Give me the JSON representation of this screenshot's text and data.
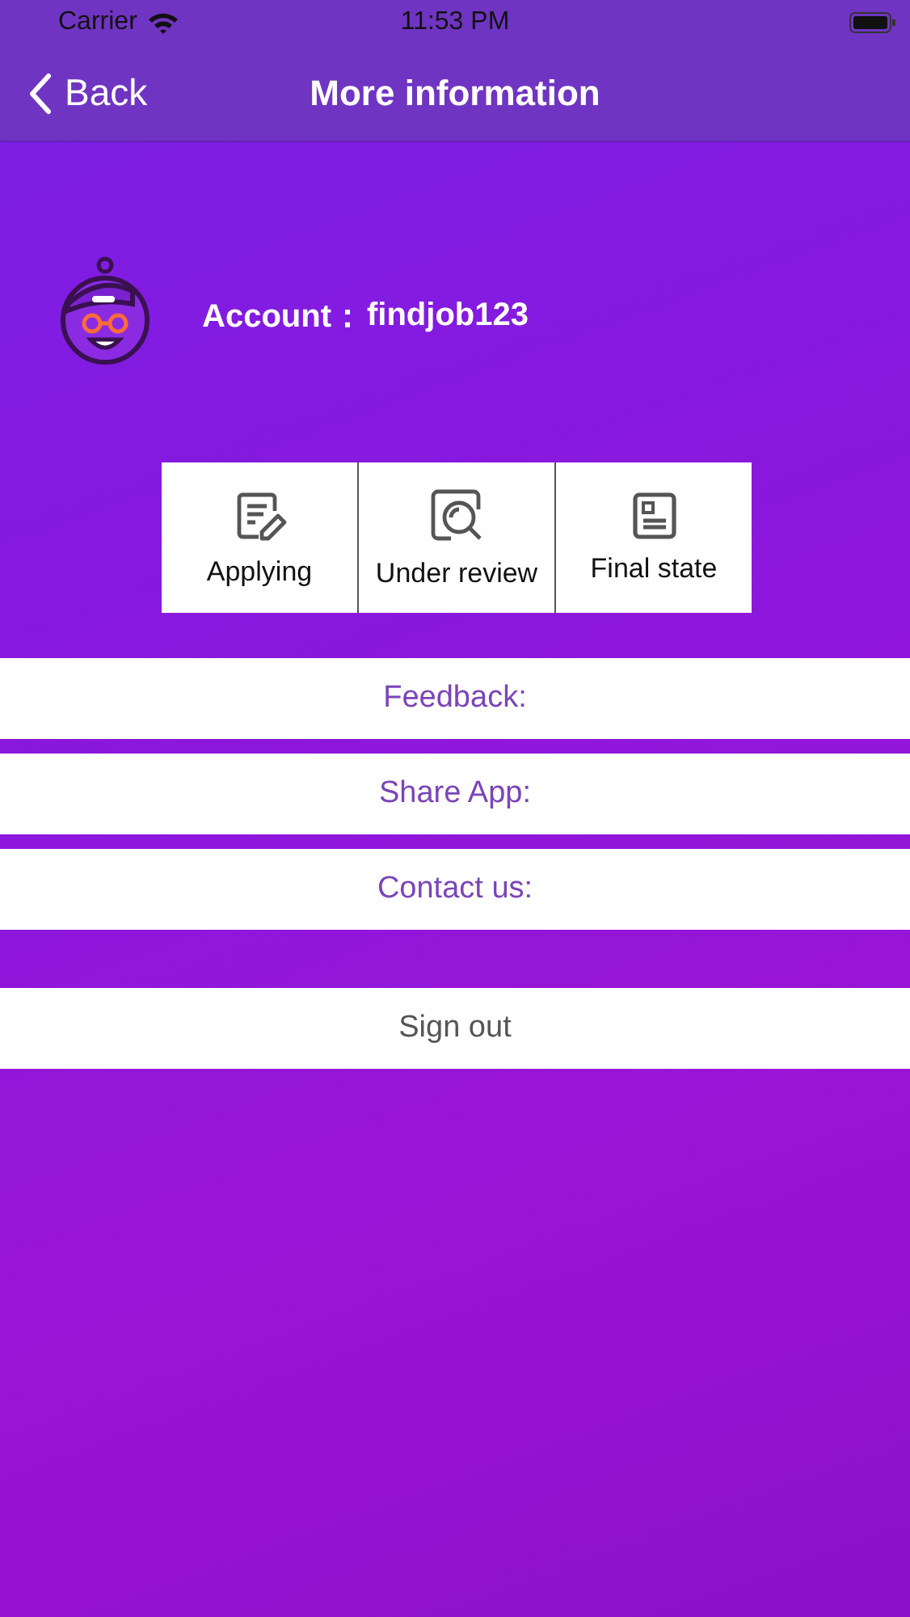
{
  "status_bar": {
    "carrier": "Carrier",
    "time": "11:53 PM"
  },
  "nav": {
    "back": "Back",
    "title": "More information"
  },
  "account": {
    "label": "Account：",
    "value": "findjob123"
  },
  "status_buttons": [
    {
      "kind": "edit",
      "label": "Applying"
    },
    {
      "kind": "search",
      "label": "Under review"
    },
    {
      "kind": "document",
      "label": "Final state"
    }
  ],
  "menu": [
    {
      "kind": "link",
      "label": "Feedback:"
    },
    {
      "kind": "link",
      "label": "Share App:"
    },
    {
      "kind": "link",
      "label": "Contact us:"
    }
  ],
  "sign_out": {
    "label": "Sign out"
  }
}
